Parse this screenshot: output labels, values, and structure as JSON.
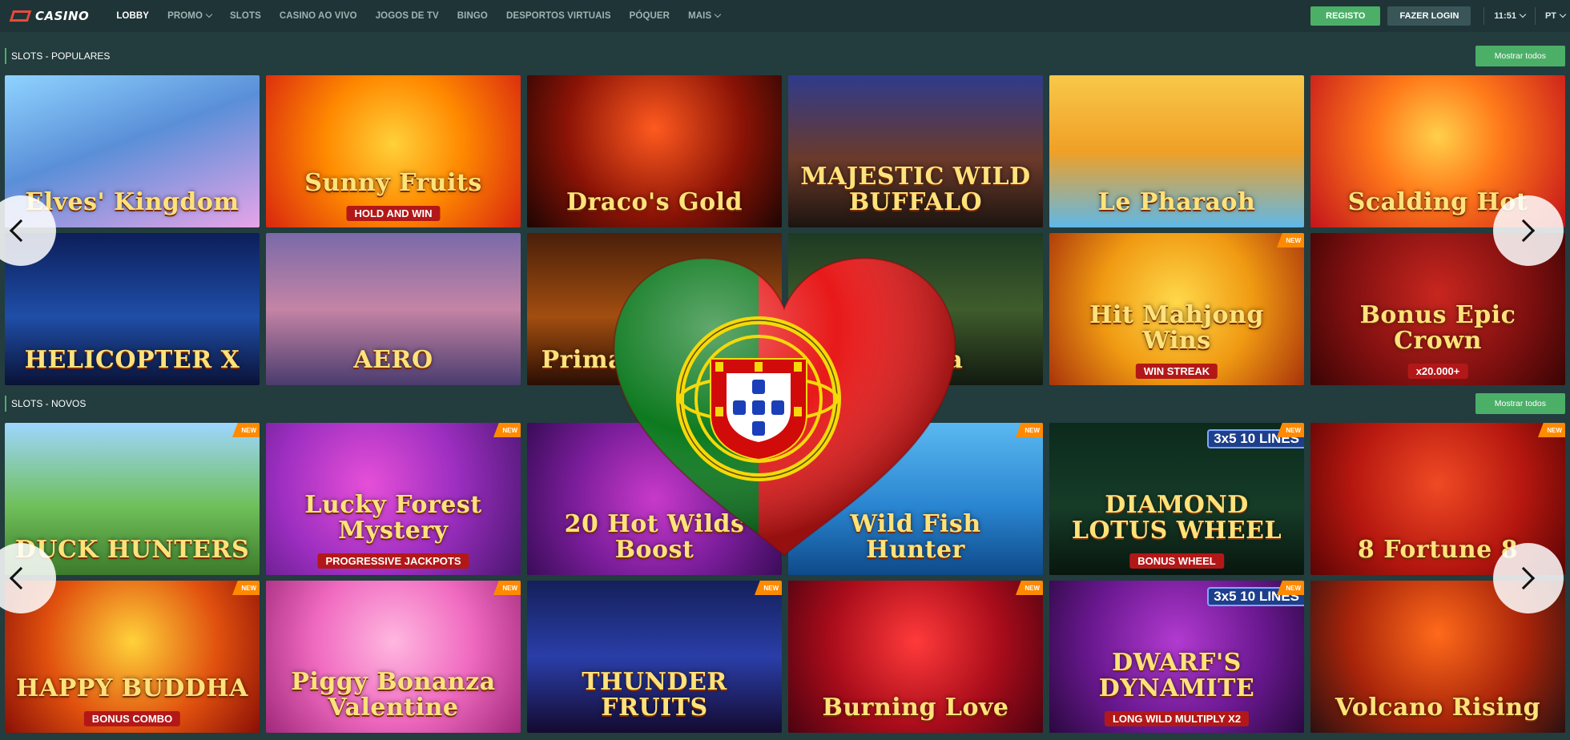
{
  "header": {
    "logo_text": "CASINO",
    "nav": [
      {
        "label": "LOBBY",
        "active": true,
        "has_menu": false
      },
      {
        "label": "PROMO",
        "active": false,
        "has_menu": true
      },
      {
        "label": "SLOTS",
        "active": false,
        "has_menu": false
      },
      {
        "label": "CASINO AO VIVO",
        "active": false,
        "has_menu": false
      },
      {
        "label": "JOGOS DE TV",
        "active": false,
        "has_menu": false
      },
      {
        "label": "BINGO",
        "active": false,
        "has_menu": false
      },
      {
        "label": "DESPORTOS VIRTUAIS",
        "active": false,
        "has_menu": false
      },
      {
        "label": "PÓQUER",
        "active": false,
        "has_menu": false
      },
      {
        "label": "MAIS",
        "active": false,
        "has_menu": true
      }
    ],
    "register_label": "REGISTO",
    "login_label": "FAZER LOGIN",
    "time": "11:51",
    "language": "PT"
  },
  "colors": {
    "accent_green": "#4caf68",
    "background": "#233c3e",
    "topbar": "#1f3436",
    "new_badge": "#ff8a00"
  },
  "sections": [
    {
      "title": "SLOTS - POPULARES",
      "show_all_label": "Mostrar todos",
      "games": [
        {
          "title": "Elves' Kingdom",
          "bg": "linear-gradient(160deg,#8fd3ff 0%,#5a8fd8 45%,#e7a4e8 100%)",
          "badge": "",
          "sub": ""
        },
        {
          "title": "Sunny Fruits",
          "bg": "radial-gradient(circle at 50% 45%,#ffd13a 0%,#ff8a00 45%,#d9260f 100%)",
          "badge": "",
          "sub": "HOLD AND WIN"
        },
        {
          "title": "Draco's Gold",
          "bg": "radial-gradient(circle at 50% 35%,#ff5a1f 0%,#8a1306 55%,#1d0502 100%)",
          "badge": "",
          "sub": ""
        },
        {
          "title": "MAJESTIC WILD BUFFALO",
          "bg": "linear-gradient(180deg,#2f3b8c 0%,#6b3a2a 55%,#1c1410 100%)",
          "badge": "",
          "sub": ""
        },
        {
          "title": "Le Pharaoh",
          "bg": "linear-gradient(180deg,#f8c84a 0%,#f0a026 50%,#5fb8e8 100%)",
          "badge": "",
          "sub": ""
        },
        {
          "title": "Scalding Hot",
          "bg": "radial-gradient(circle at 50% 40%,#ffd04a 0%,#ff7a1a 40%,#c4131b 100%)",
          "badge": "",
          "sub": ""
        },
        {
          "title": "HELICOPTER X",
          "bg": "linear-gradient(180deg,#0c1e5a 0%,#1f4ea8 55%,#0a1236 100%)",
          "badge": "",
          "sub": ""
        },
        {
          "title": "AERO",
          "bg": "linear-gradient(180deg,#7a6aa8 0%,#c484a5 50%,#4a3c6e 100%)",
          "badge": "",
          "sub": ""
        },
        {
          "title": "Primal Kingdom",
          "bg": "linear-gradient(180deg,#4a1f0a 0%,#a24e10 55%,#2a0e04 100%)",
          "badge": "",
          "sub": ""
        },
        {
          "title": "Gorilla",
          "bg": "linear-gradient(180deg,#1c3a22 0%,#3f5c2c 50%,#121a10 100%)",
          "badge": "",
          "sub": ""
        },
        {
          "title": "Hit Mahjong Wins",
          "bg": "radial-gradient(circle at 50% 45%,#ffd84a 0%,#f09a12 50%,#a8330a 100%)",
          "badge": "NEW",
          "sub": "WIN STREAK"
        },
        {
          "title": "Bonus Epic Crown",
          "bg": "radial-gradient(circle at 50% 40%,#c9261f 0%,#7c0f0f 60%,#3a0404 100%)",
          "badge": "",
          "sub": "x20.000+"
        }
      ]
    },
    {
      "title": "SLOTS - NOVOS",
      "show_all_label": "Mostrar todos",
      "games": [
        {
          "title": "DUCK HUNTERS",
          "bg": "linear-gradient(180deg,#9ed6ff 0%,#6fbf5a 55%,#3c7a2a 100%)",
          "badge": "NEW",
          "sub": ""
        },
        {
          "title": "Lucky Forest Mystery",
          "bg": "radial-gradient(circle at 40% 40%,#e64fd8 0%,#9c2ec0 50%,#4a1670 100%)",
          "badge": "NEW",
          "sub": "PROGRESSIVE JACKPOTS"
        },
        {
          "title": "20 Hot Wilds Boost",
          "bg": "radial-gradient(circle at 50% 50%,#c83ac9 0%,#7a1d9a 55%,#3a0c58 100%)",
          "badge": "",
          "sub": ""
        },
        {
          "title": "Wild Fish Hunter",
          "bg": "linear-gradient(180deg,#5ab8f0 0%,#2a85d0 55%,#0e4a8a 100%)",
          "badge": "NEW",
          "sub": ""
        },
        {
          "title": "DIAMOND LOTUS WHEEL",
          "bg": "linear-gradient(180deg,#0c2a1c 0%,#163c28 55%,#08160e 100%)",
          "badge": "NEW",
          "lines": "3x5 10 LINES",
          "sub": "BONUS WHEEL"
        },
        {
          "title": "8 Fortune 8",
          "bg": "radial-gradient(circle at 50% 40%,#f04a24 0%,#b5170f 55%,#5a0404 100%)",
          "badge": "NEW",
          "sub": ""
        },
        {
          "title": "HAPPY BUDDHA",
          "bg": "radial-gradient(circle at 50% 40%,#ffd23a 0%,#e0500e 55%,#8a0f06 100%)",
          "badge": "NEW",
          "sub": "BONUS COMBO"
        },
        {
          "title": "Piggy Bonanza Valentine",
          "bg": "radial-gradient(circle at 50% 40%,#ffb7e0 0%,#f06ac0 50%,#a0287a 100%)",
          "badge": "NEW",
          "sub": ""
        },
        {
          "title": "THUNDER FRUITS",
          "bg": "linear-gradient(180deg,#14205a 0%,#2a3ea8 50%,#140a30 100%)",
          "badge": "NEW",
          "sub": ""
        },
        {
          "title": "Burning Love",
          "bg": "radial-gradient(circle at 50% 40%,#ff3a3a 0%,#a80c1a 55%,#4a0210 100%)",
          "badge": "NEW",
          "sub": ""
        },
        {
          "title": "DWARF'S DYNAMITE",
          "bg": "radial-gradient(circle at 50% 40%,#b23ad0 0%,#6a1890 55%,#2a0840 100%)",
          "badge": "NEW",
          "lines": "3x5 10 LINES",
          "sub": "LONG WILD   MULTIPLY X2"
        },
        {
          "title": "Volcano Rising",
          "bg": "radial-gradient(circle at 50% 35%,#ff6a1a 0%,#a8240a 55%,#2a1010 100%)",
          "badge": "",
          "sub": ""
        }
      ]
    }
  ]
}
